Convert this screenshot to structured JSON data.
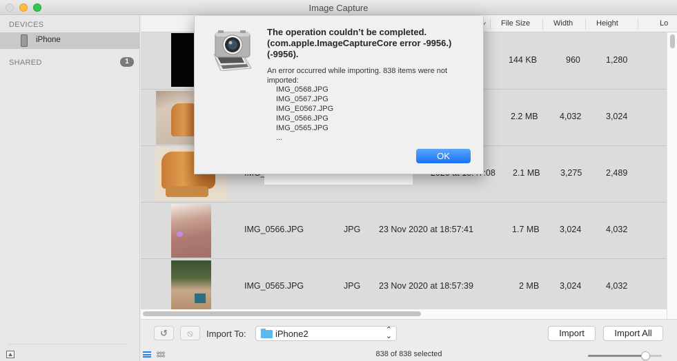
{
  "window": {
    "title": "Image Capture"
  },
  "sidebar": {
    "devices_heading": "DEVICES",
    "devices": [
      {
        "label": "iPhone",
        "icon": "iphone-icon",
        "selected": true
      }
    ],
    "shared_heading": "SHARED",
    "shared_count": "1"
  },
  "table": {
    "columns": [
      {
        "label": "✓",
        "key": "sort"
      },
      {
        "label": "File Size",
        "key": "size"
      },
      {
        "label": "Width",
        "key": "width"
      },
      {
        "label": "Height",
        "key": "height"
      },
      {
        "label": "Lo",
        "key": "location"
      }
    ],
    "rows": [
      {
        "name": "",
        "kind": "",
        "date": "",
        "size": "144 KB",
        "width": "960",
        "height": "1,280",
        "thumb": "dark"
      },
      {
        "name": "",
        "kind": "",
        "date": "",
        "size": "2.2 MB",
        "width": "4,032",
        "height": "3,024",
        "thumb": "tiger-small"
      },
      {
        "name": "IMG_",
        "kind": "",
        "date": "2020 at 18:47:08",
        "size": "2.1 MB",
        "width": "3,275",
        "height": "2,489",
        "thumb": "tiger"
      },
      {
        "name": "IMG_0566.JPG",
        "kind": "JPG",
        "date": "23 Nov 2020 at 18:57:41",
        "size": "1.7 MB",
        "width": "3,024",
        "height": "4,032",
        "thumb": "blurry"
      },
      {
        "name": "IMG_0565.JPG",
        "kind": "JPG",
        "date": "23 Nov 2020 at 18:57:39",
        "size": "2 MB",
        "width": "3,024",
        "height": "4,032",
        "thumb": "plant"
      }
    ]
  },
  "toolbar": {
    "rotate_icon": "rotate-left-icon",
    "delete_icon": "no-entry-icon",
    "import_to_label": "Import To:",
    "import_to_value": "iPhone2",
    "import_label": "Import",
    "import_all_label": "Import All",
    "status": "838 of 838 selected",
    "thumb_size_fraction": 0.78
  },
  "dialog": {
    "title": "The operation couldn’t be completed. (com.apple.ImageCaptureCore error -9956.) (-9956).",
    "message": "An error occurred while importing. 838 items were not imported:",
    "files": [
      "IMG_0568.JPG",
      "IMG_0567.JPG",
      "IMG_E0567.JPG",
      "IMG_0566.JPG",
      "IMG_0565.JPG",
      "..."
    ],
    "ok_label": "OK",
    "accent": "#1a72f3"
  }
}
